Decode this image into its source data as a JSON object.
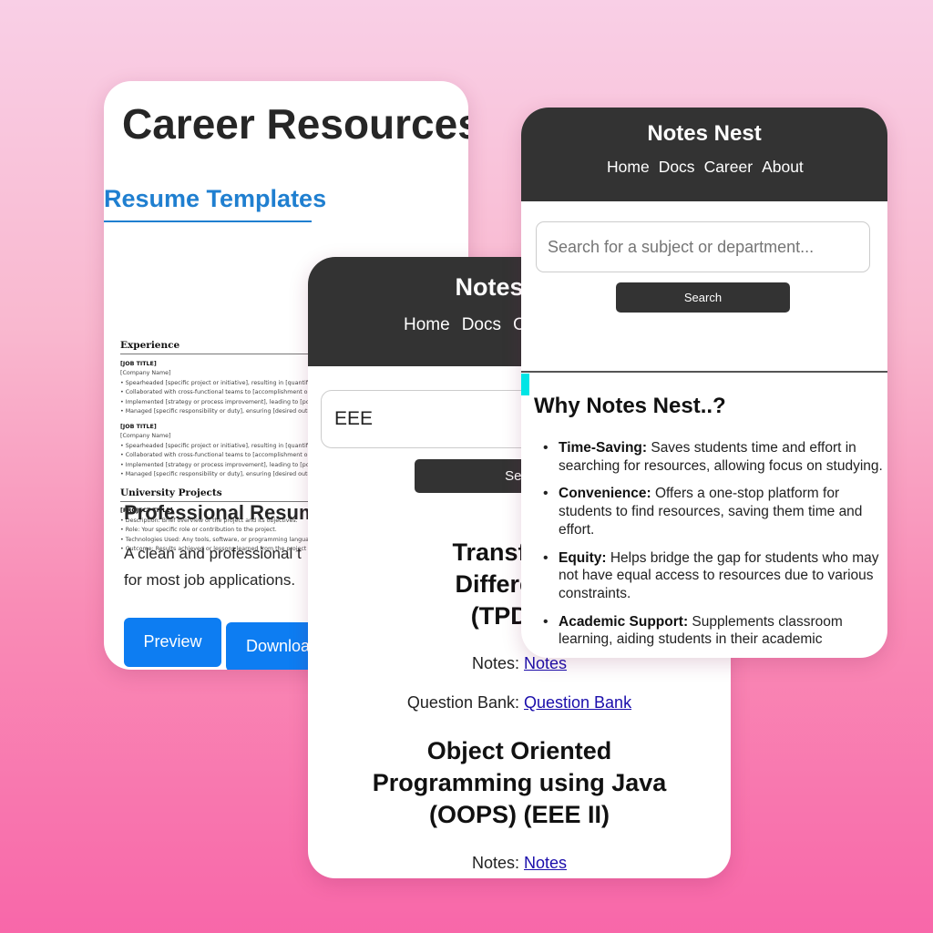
{
  "career": {
    "page_title": "Career Resources",
    "section_heading": "Resume Templates",
    "resume_preview": {
      "experience_heading": "Experience",
      "job_title": "[JOB TITLE]",
      "company": "[Company Name]",
      "bullet_1": "Spearheaded [specific project or initiative], resulting in [quantifiable outcome]",
      "bullet_2": "Collaborated with cross-functional teams to [accomplishment or result]",
      "bullet_3": "Implemented [strategy or process improvement], leading to [positive outcome]",
      "bullet_4": "Managed [specific responsibility or duty], ensuring [desired outcome]",
      "projects_heading": "University Projects",
      "project_title": "[PROJECT TITLE]",
      "project_bullet_1": "Description: Brief overview of the project and its objectives.",
      "project_bullet_2": "Role: Your specific role or contribution to the project.",
      "project_bullet_3": "Technologies Used: Any tools, software, or programming languages used",
      "project_bullet_4": "Outcome: Results achieved or lessons learned from the project"
    },
    "template_title": "Professional Resume",
    "template_desc_1": "A clean and professional t",
    "template_desc_2": "for most job applications.",
    "preview_label": "Preview",
    "download_label": "Downloa"
  },
  "results": {
    "brand": "Notes Nest",
    "nav": [
      "Home",
      "Docs",
      "C"
    ],
    "search_value": "EEE",
    "search_label": "Sear",
    "course_1": {
      "title_1": "Transforms",
      "title_2": "Differential",
      "title_3": "(TPDE) (",
      "notes_label": "Notes:",
      "notes_link": "Notes",
      "qbank_label": "Question Bank:",
      "qbank_link": "Question Bank"
    },
    "course_2": {
      "title_1": "Object Oriented",
      "title_2": "Programming using Java",
      "title_3": "(OOPS) (EEE II)",
      "notes_label": "Notes:",
      "notes_link": "Notes"
    }
  },
  "home": {
    "brand": "Notes Nest",
    "nav": [
      "Home",
      "Docs",
      "Career",
      "About"
    ],
    "search_placeholder": "Search for a subject or department...",
    "search_label": "Search",
    "why_title": "Why Notes Nest..?",
    "benefits": [
      {
        "term": "Time-Saving:",
        "text": " Saves students time and effort in searching for resources, allowing focus on studying."
      },
      {
        "term": "Convenience:",
        "text": " Offers a one-stop platform for students to find resources, saving them time and effort."
      },
      {
        "term": "Equity:",
        "text": " Helps bridge the gap for students who may not have equal access to resources due to various constraints."
      },
      {
        "term": "Academic Support:",
        "text": " Supplements classroom learning, aiding students in their academic"
      }
    ]
  },
  "colors": {
    "header_dark": "#333333",
    "accent_blue": "#0d7df2",
    "heading_blue": "#1f7fd0",
    "link_blue": "#1a0dab",
    "background_pink": "#f98cb6"
  }
}
